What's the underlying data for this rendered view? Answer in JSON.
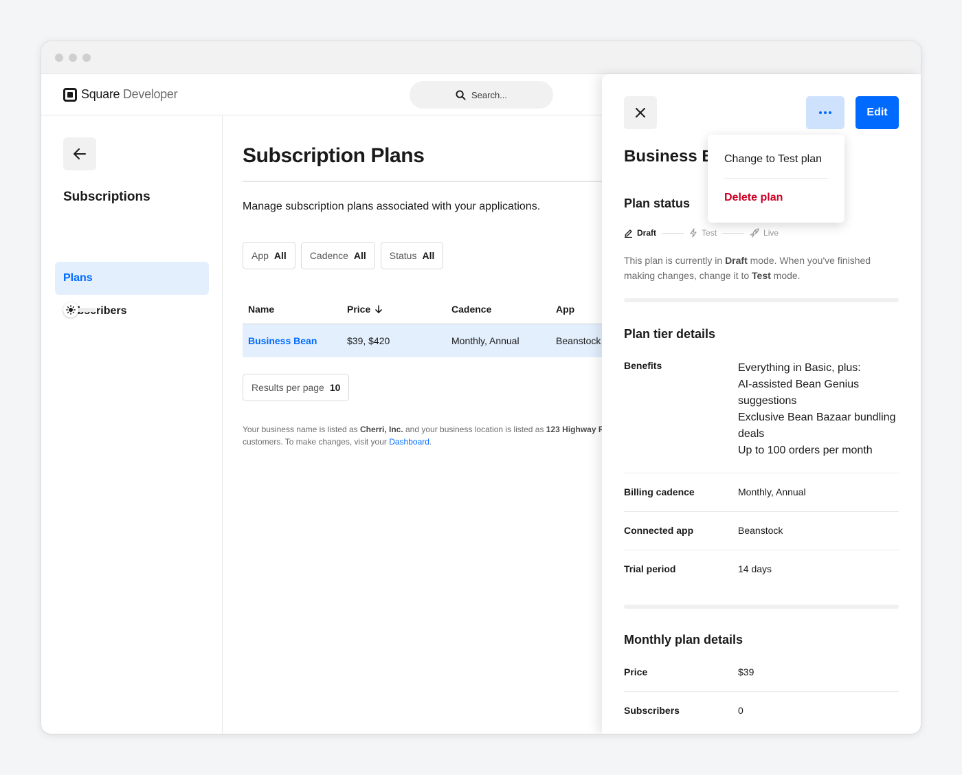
{
  "brand": {
    "name_part1": "Square",
    "name_part2": "Developer"
  },
  "search": {
    "placeholder": "Search..."
  },
  "sidebar": {
    "title": "Subscriptions",
    "items": [
      {
        "label": "Plans",
        "active": true
      },
      {
        "label": "Subscribers",
        "active": false
      }
    ]
  },
  "main": {
    "title": "Subscription Plans",
    "description": "Manage subscription plans associated with your applications.",
    "filters": [
      {
        "label": "App",
        "value": "All"
      },
      {
        "label": "Cadence",
        "value": "All"
      },
      {
        "label": "Status",
        "value": "All"
      }
    ],
    "table": {
      "headers": [
        "Name",
        "Price",
        "Cadence",
        "App"
      ],
      "rows": [
        {
          "name": "Business Bean",
          "price": "$39, $420",
          "cadence": "Monthly, Annual",
          "app": "Beanstock"
        }
      ]
    },
    "results_per_page": {
      "label": "Results per page",
      "value": "10"
    },
    "footnote": {
      "part1": "Your business name is listed as ",
      "business_name": "Cherri, Inc.",
      "part2": " and your business location is listed as ",
      "location": "123 Highway R",
      "part3": "customers. To make changes, visit your ",
      "link": "Dashboard",
      "part4": "."
    }
  },
  "panel": {
    "title": "Business Bean",
    "edit_label": "Edit",
    "plan_status": {
      "heading": "Plan status",
      "steps": [
        "Draft",
        "Test",
        "Live"
      ],
      "note_part1": "This plan is currently in ",
      "note_mode": "Draft",
      "note_part2": " mode. When you've finished making changes, change it to ",
      "note_target": "Test",
      "note_part3": " mode."
    },
    "tier_details": {
      "heading": "Plan tier details",
      "benefits_label": "Benefits",
      "benefits": [
        "Everything in Basic, plus:",
        "AI-assisted Bean Genius suggestions",
        "Exclusive Bean Bazaar bundling deals",
        "Up to 100 orders per month"
      ],
      "billing_cadence_label": "Billing cadence",
      "billing_cadence": "Monthly, Annual",
      "connected_app_label": "Connected app",
      "connected_app": "Beanstock",
      "trial_period_label": "Trial period",
      "trial_period": "14 days"
    },
    "monthly_details": {
      "heading": "Monthly plan details",
      "price_label": "Price",
      "price": "$39",
      "subscribers_label": "Subscribers",
      "subscribers": "0"
    }
  },
  "dropdown": {
    "items": [
      {
        "label": "Change to Test plan"
      },
      {
        "label": "Delete plan"
      }
    ]
  },
  "colors": {
    "accent": "#006aff",
    "danger": "#cc0023",
    "active_bg": "#e3effd"
  }
}
